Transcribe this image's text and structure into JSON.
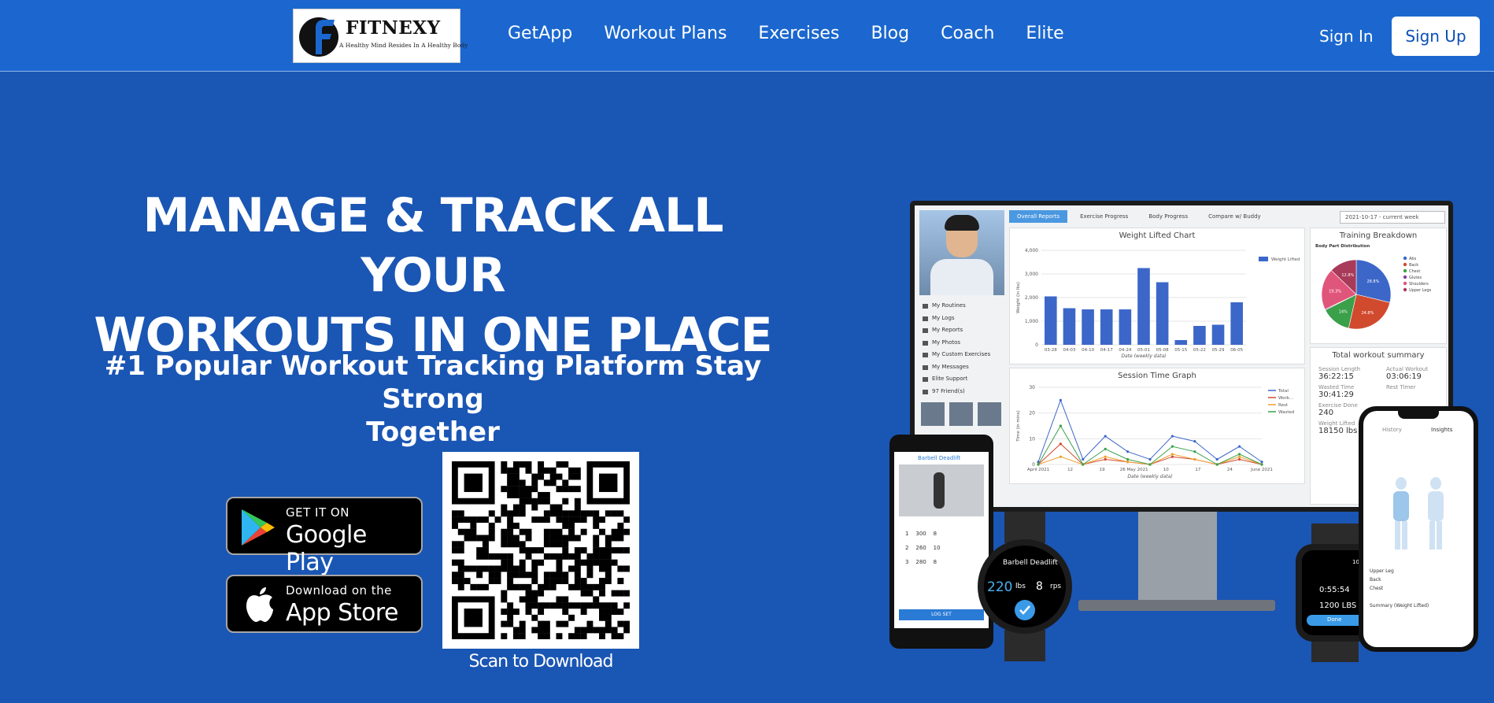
{
  "brand": {
    "name": "FITNEXY",
    "tagline": "A Healthy Mind Resides In A Healthy Body"
  },
  "nav": {
    "links": [
      "GetApp",
      "Workout Plans",
      "Exercises",
      "Blog",
      "Coach",
      "Elite"
    ],
    "sign_in": "Sign In",
    "sign_up": "Sign Up"
  },
  "hero": {
    "title_line1": "MANAGE & TRACK ALL YOUR",
    "title_line2": "WORKOUTS IN ONE PLACE",
    "subtitle_line1": "#1 Popular Workout Tracking Platform Stay Strong",
    "subtitle_line2": "Together"
  },
  "stores": {
    "google_small": "GET IT ON",
    "google_big": "Google Play",
    "apple_small": "Download on the",
    "apple_big": "App Store"
  },
  "qr": {
    "caption": "Scan to Download"
  },
  "mockup": {
    "tabs": [
      "Overall Reports",
      "Exercise Progress",
      "Body Progress",
      "Compare w/ Buddy"
    ],
    "week_select": "2021-10-17 - current week",
    "side_menu": [
      "My Routines",
      "My Logs",
      "My Reports",
      "My Photos",
      "My Custom Exercises",
      "My Messages",
      "Elite Support",
      "97 Friend(s)"
    ],
    "weight_chart_title": "Weight Lifted Chart",
    "session_chart_title": "Session Time Graph",
    "breakdown_title": "Training Breakdown",
    "breakdown_subtitle": "Body Part Distribution",
    "summary_title": "Total workout summary",
    "summary": {
      "session_length_label": "Session Length",
      "session_length": "36:22:15",
      "actual_workout_label": "Actual Workout",
      "actual_workout": "03:06:19",
      "wasted_time_label": "Wasted Time",
      "wasted_time": "30:41:29",
      "rest_timer_label": "Rest Timer",
      "exercise_done_label": "Exercise Done",
      "exercise_done": "240",
      "weight_lifted_label": "Weight Lifted",
      "weight_lifted": "18150 lbs"
    },
    "watch_left": {
      "exercise": "Barbell Deadlift",
      "weight": "220",
      "unit": "lbs",
      "reps": "8",
      "reps_unit": "rps"
    },
    "watch_right": {
      "time": "10:12",
      "duration": "0:55:54",
      "load": "1200 LBS",
      "done": "Done"
    },
    "phone_right": {
      "tab_history": "History",
      "tab_insights": "Insights",
      "rows": [
        "Upper Leg",
        "Back",
        "Chest"
      ],
      "summary": "Summary (Weight Lifted)"
    },
    "phone_left": {
      "exercise": "Barbell Deadlift",
      "log_set": "LOG SET",
      "sets": [
        {
          "set": "1",
          "weight": "300",
          "reps": "8"
        },
        {
          "set": "2",
          "weight": "260",
          "reps": "10"
        },
        {
          "set": "3",
          "weight": "280",
          "reps": "8"
        }
      ]
    }
  },
  "chart_data": [
    {
      "type": "bar",
      "title": "Weight Lifted Chart",
      "xlabel": "Date (weekly data)",
      "ylabel": "Weight (in lbs)",
      "categories": [
        "03-28",
        "04-03",
        "04-10",
        "04-17",
        "04-24",
        "05-01",
        "05-08",
        "05-15",
        "05-22",
        "05-29",
        "06-05"
      ],
      "series": [
        {
          "name": "Weight Lifted",
          "values": [
            2050,
            1550,
            1500,
            1500,
            1500,
            3250,
            2650,
            200,
            800,
            850,
            1800
          ]
        }
      ],
      "ylim": [
        0,
        4000
      ],
      "yticks": [
        "0",
        "1,000",
        "2,000",
        "3,000",
        "4,000"
      ],
      "colors": [
        "#3c67c9"
      ]
    },
    {
      "type": "line",
      "title": "Session Time Graph",
      "xlabel": "Date (weekly data)",
      "ylabel": "Time (in mins)",
      "x": [
        "April 2021",
        "12",
        "19",
        "26 May 2021",
        "10",
        "17",
        "24",
        "June 2021"
      ],
      "ylim": [
        0,
        30
      ],
      "yticks": [
        "0",
        "10",
        "20",
        "30"
      ],
      "series": [
        {
          "name": "Total",
          "color": "#3c67c9",
          "values": [
            1,
            25,
            2,
            11,
            5,
            2,
            11,
            9,
            2,
            7,
            1
          ]
        },
        {
          "name": "Work...",
          "color": "#d14a2e",
          "values": [
            0,
            8,
            0,
            2,
            1,
            0,
            3,
            2,
            0,
            2,
            0
          ]
        },
        {
          "name": "Rest",
          "color": "#f0a030",
          "values": [
            0,
            3,
            0,
            3,
            1,
            0,
            4,
            2,
            0,
            3,
            0
          ]
        },
        {
          "name": "Wasted",
          "color": "#3aa04a",
          "values": [
            0,
            15,
            0,
            6,
            2,
            0,
            7,
            5,
            0,
            4,
            0
          ]
        }
      ]
    },
    {
      "type": "pie",
      "title": "Training Breakdown",
      "subtitle": "Body Part Distribution",
      "labels": [
        "Abs",
        "Back",
        "Chest",
        "Glutes",
        "Shoulders",
        "Upper Legs"
      ],
      "values": [
        28.8,
        24.8,
        14.0,
        0.4,
        19.3,
        12.8
      ],
      "slice_labels": [
        "28.8%",
        "24.8%",
        "14%",
        "",
        "19.3%",
        "12.8%"
      ],
      "colors": [
        "#3c67c9",
        "#d14a2e",
        "#3aa04a",
        "#8a3aa8",
        "#e0557a",
        "#a83a5a"
      ]
    }
  ]
}
